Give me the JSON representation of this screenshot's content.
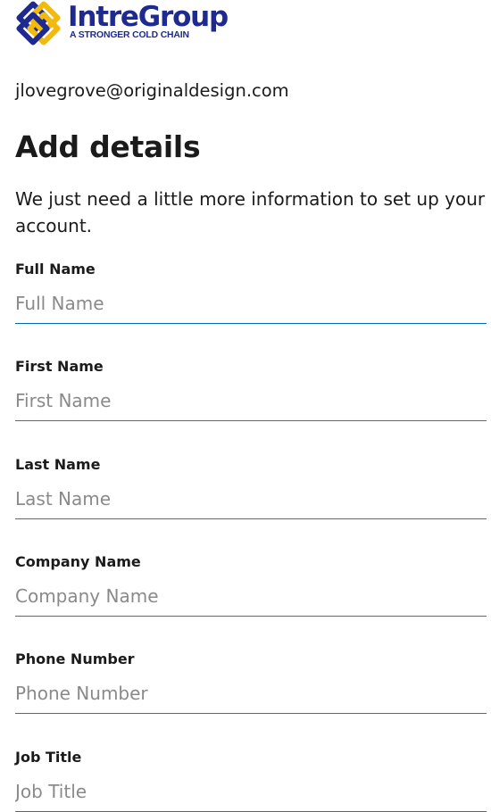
{
  "brand": {
    "name": "IntreGroup",
    "tagline": "A STRONGER COLD CHAIN",
    "logo_icon": "interlocking-chain-logo",
    "colors": {
      "navy": "#1e2a8f",
      "gold": "#f2b90f"
    }
  },
  "account": {
    "email": "jlovegrove@originaldesign.com"
  },
  "page": {
    "title": "Add details",
    "intro": "We just need a little more information to set up your account."
  },
  "form": {
    "fields": [
      {
        "label": "Full Name",
        "placeholder": "Full Name",
        "value": ""
      },
      {
        "label": "First Name",
        "placeholder": "First Name",
        "value": ""
      },
      {
        "label": "Last Name",
        "placeholder": "Last Name",
        "value": ""
      },
      {
        "label": "Company Name",
        "placeholder": "Company Name",
        "value": ""
      },
      {
        "label": "Phone Number",
        "placeholder": "Phone Number",
        "value": ""
      },
      {
        "label": "Job Title",
        "placeholder": "Job Title",
        "value": ""
      }
    ]
  },
  "colors": {
    "focus_underline": "#0067b8",
    "underline": "#666666",
    "placeholder": "#8a8a8a"
  }
}
